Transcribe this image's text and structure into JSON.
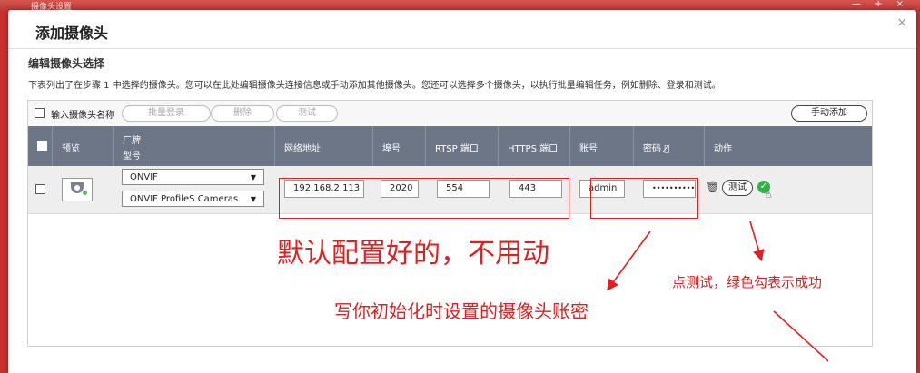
{
  "window": {
    "title": "摄像头设置",
    "controls": "— + ×"
  },
  "dialog": {
    "title": "添加摄像头",
    "close_icon": "×"
  },
  "section": {
    "title": "编辑摄像头选择",
    "description": "下表列出了在步骤 1 中选择的摄像头。您可以在此处编辑摄像头连接信息或手动添加其他摄像头。您还可以选择多个摄像头，以执行批量编辑任务，例如删除、登录和测试。"
  },
  "toolbar": {
    "name_label": "输入摄像头名称",
    "batch_login": "批量登录",
    "delete": "删除",
    "test": "测试",
    "manual_add": "手动添加"
  },
  "table": {
    "headers": {
      "preview": "预览",
      "vendor": "厂牌",
      "model": "型号",
      "address": "网络地址",
      "port": "埠号",
      "rtsp": "RTSP 端口",
      "https": "HTTPS 端口",
      "account": "账号",
      "password": "密码",
      "action": "动作"
    },
    "rows": [
      {
        "vendor": "ONVIF",
        "model": "ONVIF ProfileS Cameras",
        "address": "192.168.2.113",
        "port": "2020",
        "rtsp": "554",
        "https": "443",
        "account": "admin",
        "password": "••••••••••",
        "test": "测试"
      }
    ]
  },
  "annotations": {
    "default_ok": "默认配置好的，不用动",
    "write_account": "写你初始化时设置的摄像头账密",
    "click_test": "点测试，绿色勾表示成功"
  },
  "colors": {
    "header_bg": "#6c7687",
    "annotation_red": "#e02020",
    "success_green": "#2fb344",
    "backdrop_red": "#c9302c"
  }
}
